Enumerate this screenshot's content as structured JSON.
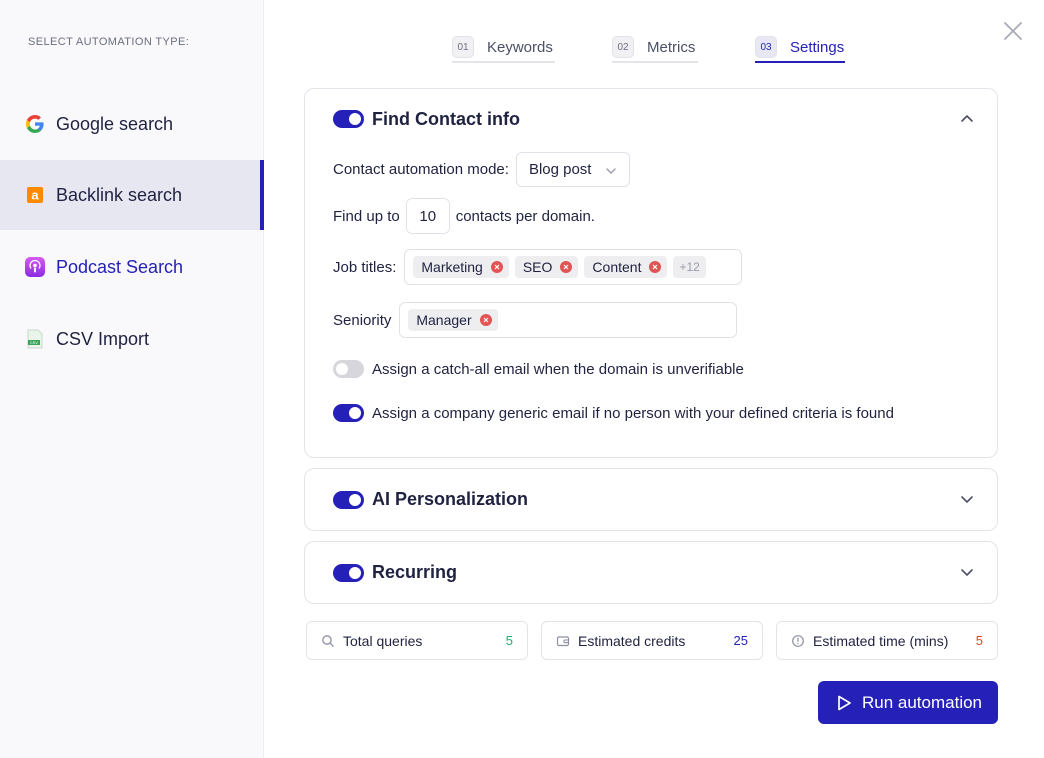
{
  "sidebar": {
    "heading": "SELECT AUTOMATION TYPE:",
    "items": [
      {
        "label": "Google search",
        "icon": "google-icon"
      },
      {
        "label": "Backlink search",
        "icon": "ahrefs-icon"
      },
      {
        "label": "Podcast Search",
        "icon": "podcast-icon"
      },
      {
        "label": "CSV Import",
        "icon": "csv-file-icon"
      }
    ],
    "active_index": 1
  },
  "tabs": [
    {
      "num": "01",
      "label": "Keywords"
    },
    {
      "num": "02",
      "label": "Metrics"
    },
    {
      "num": "03",
      "label": "Settings"
    }
  ],
  "active_tab": 2,
  "contact": {
    "title": "Find Contact info",
    "enabled": true,
    "mode_label": "Contact automation mode:",
    "mode_value": "Blog post",
    "find_prefix": "Find up to",
    "find_value": "10",
    "find_suffix": "contacts per domain.",
    "job_titles_label": "Job titles:",
    "job_titles": [
      "Marketing",
      "SEO",
      "Content"
    ],
    "job_titles_more": "+12",
    "seniority_label": "Seniority",
    "seniority": [
      "Manager"
    ],
    "option_catchall": {
      "label": "Assign a catch-all email when the domain is unverifiable",
      "enabled": false
    },
    "option_generic": {
      "label": "Assign a company generic email if no person with your defined criteria is found",
      "enabled": true
    }
  },
  "ai": {
    "title": "AI Personalization",
    "enabled": true
  },
  "recurring": {
    "title": "Recurring",
    "enabled": true
  },
  "stats": {
    "queries": {
      "label": "Total queries",
      "value": "5",
      "color": "#1fae6e"
    },
    "credits": {
      "label": "Estimated credits",
      "value": "25",
      "color": "#2521b8"
    },
    "time": {
      "label": "Estimated time (mins)",
      "value": "5",
      "color": "#e0452f"
    }
  },
  "run_label": "Run automation",
  "colors": {
    "accent": "#2521b8"
  }
}
